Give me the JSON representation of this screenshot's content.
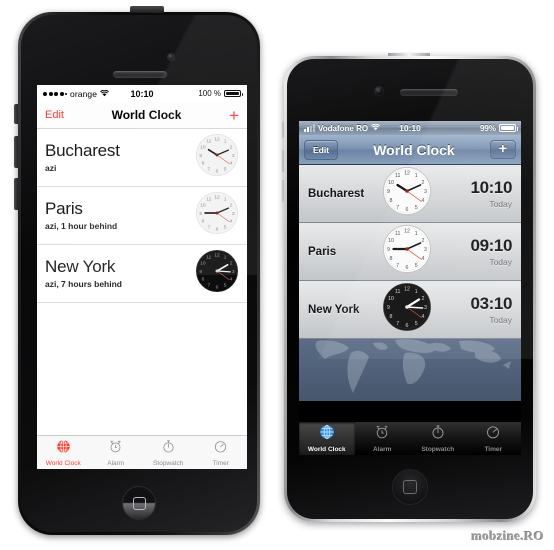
{
  "background": "#ffffff",
  "watermark": "mobzine.RO",
  "phone_left": {
    "device": "iphone-5-black",
    "os": "iOS 7",
    "status_bar": {
      "signal_dots_filled": 4,
      "signal_dots_total": 5,
      "carrier": "orange",
      "wifi_icon": "wifi-icon",
      "time": "10:10",
      "battery_percent": "100 %",
      "battery_level": 100
    },
    "nav": {
      "edit_label": "Edit",
      "title": "World Clock",
      "add_label": "+",
      "accent_color": "#ff3b30"
    },
    "rows": [
      {
        "city": "Bucharest",
        "subtitle": "azi",
        "clock": "10:10",
        "night": false
      },
      {
        "city": "Paris",
        "subtitle": "azi, 1 hour behind",
        "clock": "09:10",
        "night": false
      },
      {
        "city": "New York",
        "subtitle": "azi, 7 hours behind",
        "clock": "03:10",
        "night": true
      }
    ],
    "tabs": [
      {
        "label": "World Clock",
        "icon": "globe-icon",
        "active": true
      },
      {
        "label": "Alarm",
        "icon": "alarm-clock-icon",
        "active": false
      },
      {
        "label": "Stopwatch",
        "icon": "stopwatch-icon",
        "active": false
      },
      {
        "label": "Timer",
        "icon": "timer-icon",
        "active": false
      }
    ],
    "home_button_icon": "rounded-square-icon"
  },
  "phone_right": {
    "device": "iphone-4s-silver",
    "os": "iOS 6",
    "status_bar": {
      "signal_bars_filled": 2,
      "signal_bars_total": 4,
      "carrier": "Vodafone RO",
      "wifi_icon": "wifi-icon",
      "time": "10:10",
      "battery_percent": "99%",
      "battery_level": 99
    },
    "nav": {
      "edit_label": "Edit",
      "title": "World Clock",
      "add_label": "+"
    },
    "rows": [
      {
        "city": "Bucharest",
        "time": "10:10",
        "day": "Today",
        "night": false
      },
      {
        "city": "Paris",
        "time": "09:10",
        "day": "Today",
        "night": false
      },
      {
        "city": "New York",
        "time": "03:10",
        "day": "Today",
        "night": true
      }
    ],
    "tabs": [
      {
        "label": "World Clock",
        "icon": "globe-icon",
        "active": true
      },
      {
        "label": "Alarm",
        "icon": "alarm-clock-icon",
        "active": false
      },
      {
        "label": "Stopwatch",
        "icon": "stopwatch-icon",
        "active": false
      },
      {
        "label": "Timer",
        "icon": "timer-icon",
        "active": false
      }
    ],
    "home_button_icon": "rounded-square-icon"
  }
}
